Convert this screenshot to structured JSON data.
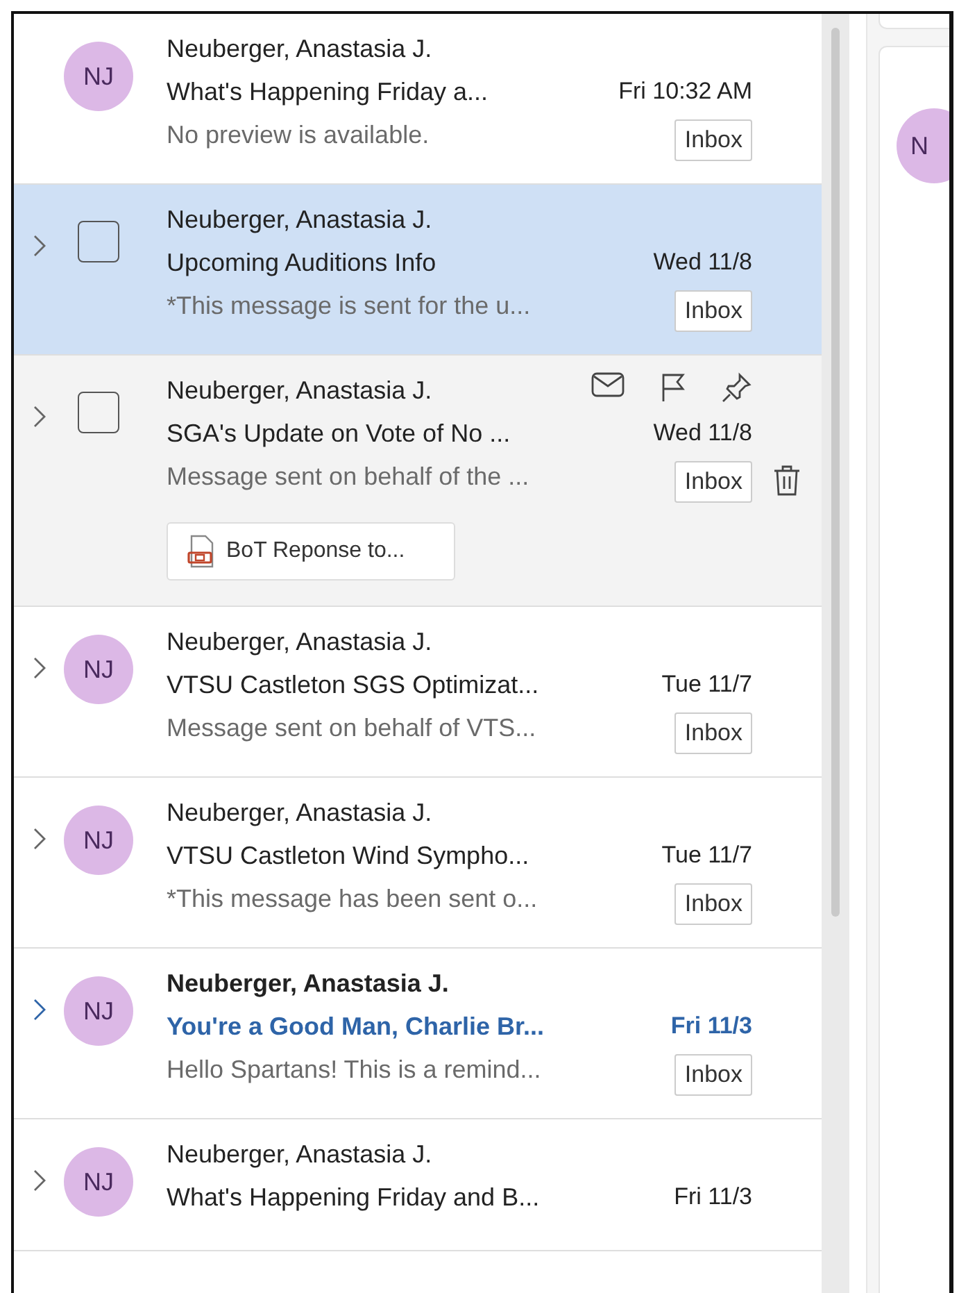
{
  "messages": [
    {
      "sender": "Neuberger, Anastasia J.",
      "subject": "What's Happening Friday a...",
      "preview": "No preview is available.",
      "date": "Fri 10:32 AM",
      "folder": "Inbox",
      "avatar": "NJ",
      "expandable": false,
      "selected": false,
      "hovered": false,
      "unread": false
    },
    {
      "sender": "Neuberger, Anastasia J.",
      "subject": "Upcoming Auditions Info",
      "preview": "*This message is sent for the u...",
      "date": "Wed 11/8",
      "folder": "Inbox",
      "checked": false,
      "expandable": true,
      "selected": true,
      "hovered": false,
      "unread": false
    },
    {
      "sender": "Neuberger, Anastasia J.",
      "subject": "SGA's Update on Vote of No ...",
      "preview": "Message sent on behalf of the ...",
      "date": "Wed 11/8",
      "folder": "Inbox",
      "checked": false,
      "attachment": "BoT Reponse to...",
      "expandable": true,
      "selected": false,
      "hovered": true,
      "unread": false
    },
    {
      "sender": "Neuberger, Anastasia J.",
      "subject": "VTSU Castleton SGS Optimizat...",
      "preview": "Message sent on behalf of VTS...",
      "date": "Tue 11/7",
      "folder": "Inbox",
      "avatar": "NJ",
      "expandable": true,
      "selected": false,
      "hovered": false,
      "unread": false
    },
    {
      "sender": "Neuberger, Anastasia J.",
      "subject": "VTSU Castleton Wind Sympho...",
      "preview": "*This message has been sent o...",
      "date": "Tue 11/7",
      "folder": "Inbox",
      "avatar": "NJ",
      "expandable": true,
      "selected": false,
      "hovered": false,
      "unread": false
    },
    {
      "sender": "Neuberger, Anastasia J.",
      "subject": "You're a Good Man, Charlie Br...",
      "preview": "Hello Spartans! This is a remind...",
      "date": "Fri 11/3",
      "folder": "Inbox",
      "avatar": "NJ",
      "expandable": true,
      "selected": false,
      "hovered": false,
      "unread": true
    },
    {
      "sender": "Neuberger, Anastasia J.",
      "subject": "What's Happening Friday and B...",
      "date": "Fri 11/3",
      "avatar": "NJ",
      "expandable": true,
      "selected": false,
      "hovered": false,
      "unread": false
    }
  ],
  "reading_pane": {
    "avatar": "N"
  }
}
